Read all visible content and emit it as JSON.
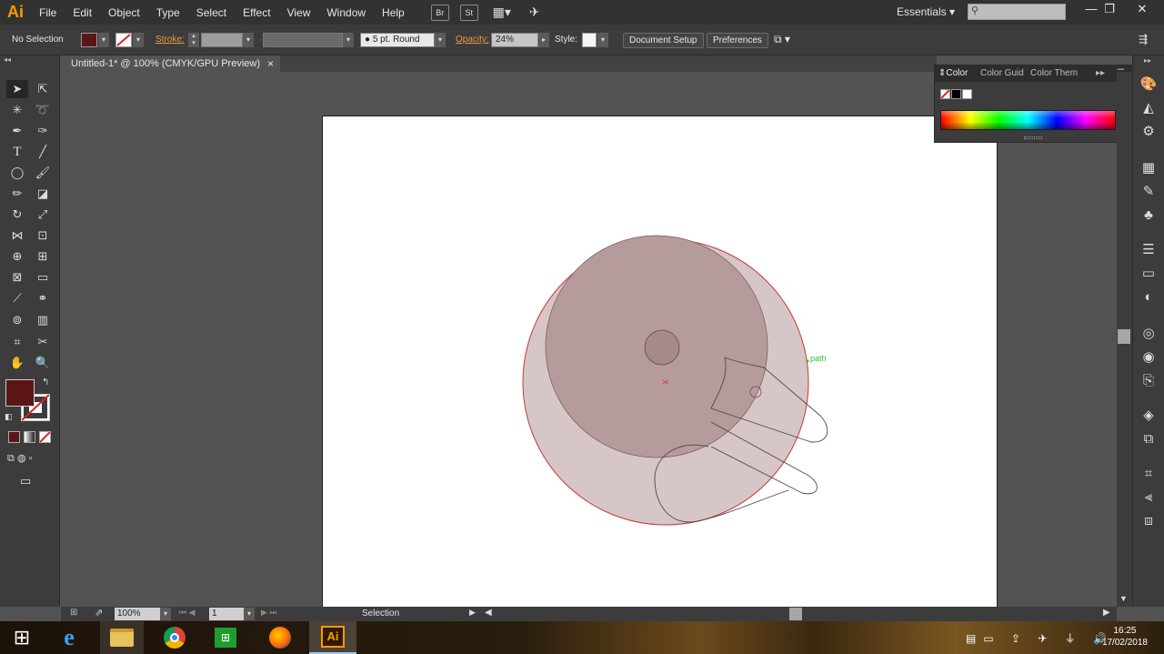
{
  "app": {
    "logo": "Ai",
    "menus": [
      "File",
      "Edit",
      "Object",
      "Type",
      "Select",
      "Effect",
      "View",
      "Window",
      "Help"
    ],
    "bridge_label": "Br",
    "stock_label": "St",
    "workspace": "Essentials",
    "window_controls": [
      "—",
      "❐",
      "✕"
    ]
  },
  "control_bar": {
    "selection_status": "No Selection",
    "stroke_label": "Stroke:",
    "brush_value": "5 pt. Round",
    "opacity_label": "Opacity:",
    "opacity_value": "24%",
    "style_label": "Style:",
    "document_setup": "Document Setup",
    "preferences": "Preferences"
  },
  "document_tab": {
    "title": "Untitled-1* @ 100% (CMYK/GPU Preview)",
    "close": "×"
  },
  "color_panel": {
    "tabs": [
      "Color",
      "Color Guide",
      "Color Them"
    ],
    "active_tab": "Color"
  },
  "canvas": {
    "hover_label": "path"
  },
  "status_bar": {
    "zoom": "100%",
    "artboard": "1",
    "tool_status": "Selection"
  },
  "taskbar": {
    "time": "16:25",
    "date": "17/02/2018",
    "ai_label": "Ai"
  },
  "colors": {
    "fill_swatch": "#5c1517",
    "accent": "#ff9a00"
  }
}
